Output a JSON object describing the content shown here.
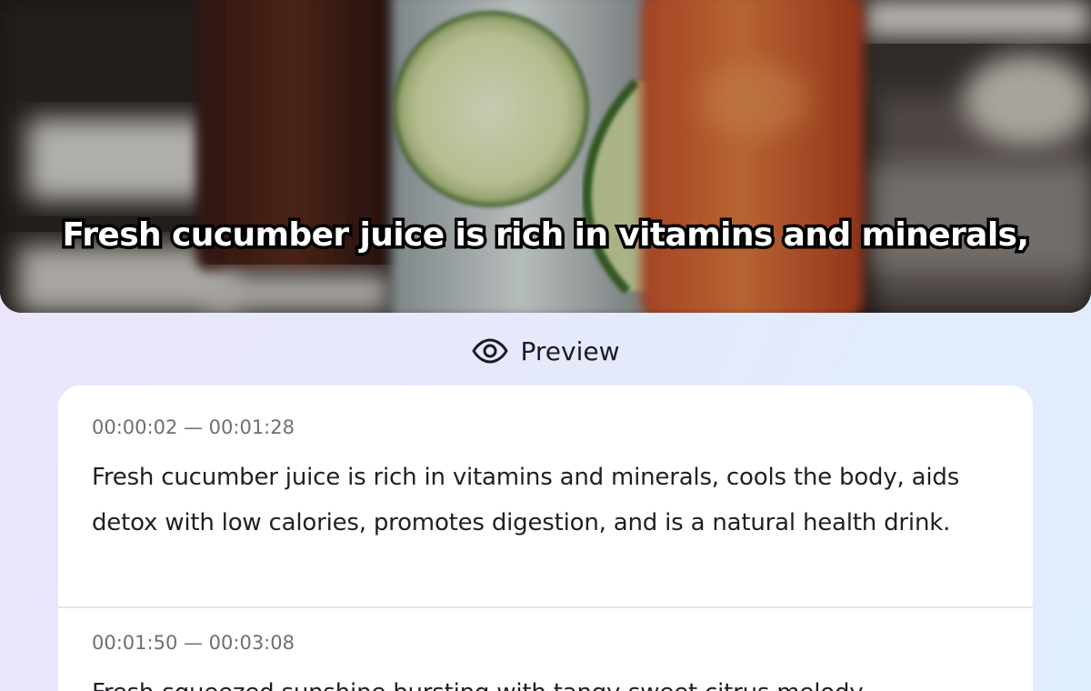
{
  "video": {
    "subtitle": "Fresh cucumber juice is rich in vitamins and minerals,"
  },
  "preview": {
    "icon": "eye-icon",
    "label": "Preview"
  },
  "segments": [
    {
      "timestamp": "00:00:02 — 00:01:28",
      "text": "Fresh cucumber juice is rich in vitamins and minerals, cools the body, aids detox with low calories, promotes digestion, and is a natural health drink."
    },
    {
      "timestamp": "00:01:50 — 00:03:08",
      "text": "Fresh-squeezed sunshine bursting with tangy-sweet citrus melody"
    }
  ]
}
